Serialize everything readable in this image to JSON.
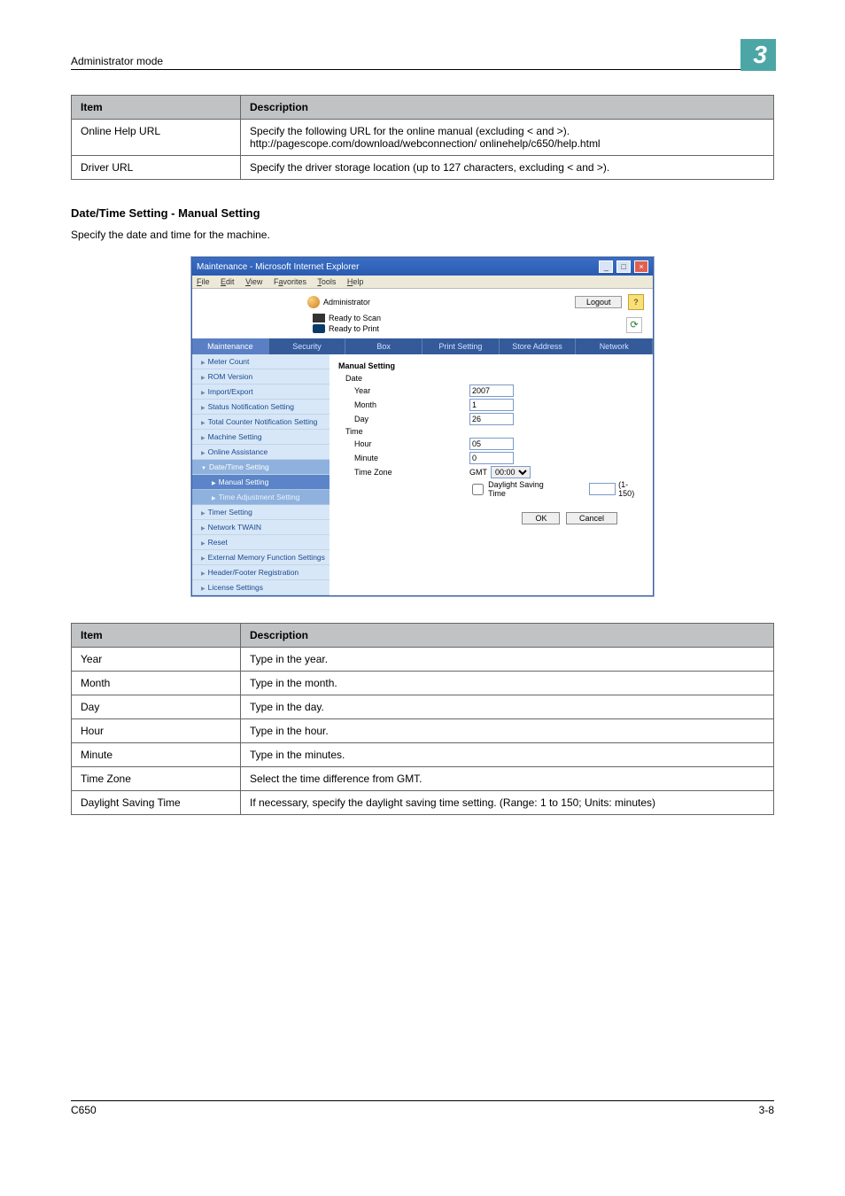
{
  "header": {
    "left": "Administrator mode",
    "chapter": "3"
  },
  "table1": {
    "headers": [
      "Item",
      "Description"
    ],
    "rows": [
      {
        "item": "Online Help URL",
        "desc": "Specify the following URL for the online manual (excluding < and >).\nhttp://pagescope.com/download/webconnection/ onlinehelp/c650/help.html"
      },
      {
        "item": "Driver URL",
        "desc": "Specify the driver storage location (up to 127 characters, excluding < and >)."
      }
    ]
  },
  "section": {
    "title": "Date/Time Setting - Manual Setting",
    "intro": "Specify the date and time for the machine."
  },
  "screenshot": {
    "window_title": "Maintenance - Microsoft Internet Explorer",
    "menus": [
      "File",
      "Edit",
      "View",
      "Favorites",
      "Tools",
      "Help"
    ],
    "admin_label": "Administrator",
    "logout": "Logout",
    "status1": "Ready to Scan",
    "status2": "Ready to Print",
    "tabs": [
      "Maintenance",
      "Security",
      "Box",
      "Print Setting",
      "Store Address",
      "Network"
    ],
    "sidebar": [
      "Meter Count",
      "ROM Version",
      "Import/Export",
      "Status Notification Setting",
      "Total Counter Notification Setting",
      "Machine Setting",
      "Online Assistance",
      "Date/Time Setting",
      "Manual Setting",
      "Time Adjustment Setting",
      "Timer Setting",
      "Network TWAIN",
      "Reset",
      "External Memory Function Settings",
      "Header/Footer Registration",
      "License Settings"
    ],
    "form": {
      "title": "Manual Setting",
      "date_label": "Date",
      "year_label": "Year",
      "year_value": "2007",
      "month_label": "Month",
      "month_value": "1",
      "day_label": "Day",
      "day_value": "26",
      "time_label": "Time",
      "hour_label": "Hour",
      "hour_value": "05",
      "minute_label": "Minute",
      "minute_value": "0",
      "tz_label": "Time Zone",
      "tz_prefix": "GMT",
      "tz_value": "00:00",
      "dst_label": "Daylight Saving Time",
      "dst_unit": "(1-150)",
      "ok": "OK",
      "cancel": "Cancel"
    }
  },
  "table2": {
    "headers": [
      "Item",
      "Description"
    ],
    "rows": [
      {
        "item": "Year",
        "desc": "Type in the year."
      },
      {
        "item": "Month",
        "desc": "Type in the month."
      },
      {
        "item": "Day",
        "desc": "Type in the day."
      },
      {
        "item": "Hour",
        "desc": "Type in the hour."
      },
      {
        "item": "Minute",
        "desc": "Type in the minutes."
      },
      {
        "item": "Time Zone",
        "desc": "Select the time difference from GMT."
      },
      {
        "item": "Daylight Saving Time",
        "desc": "If necessary, specify the daylight saving time setting. (Range: 1 to 150; Units: minutes)"
      }
    ]
  },
  "footer": {
    "left": "C650",
    "right": "3-8"
  }
}
